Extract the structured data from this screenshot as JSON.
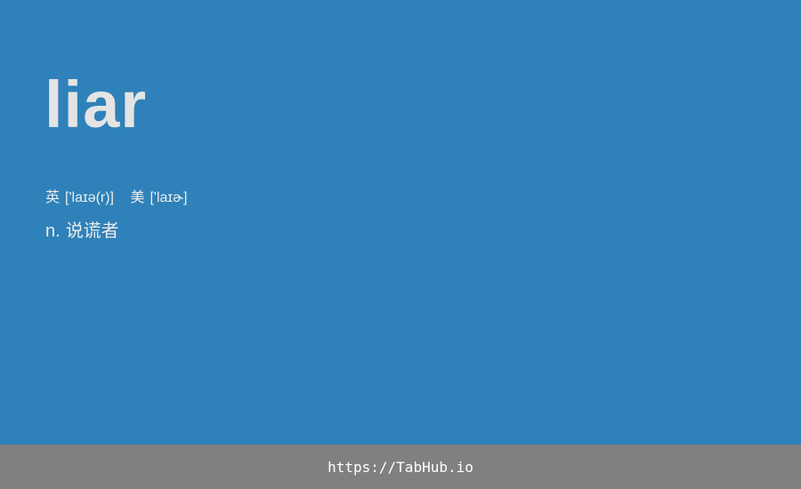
{
  "entry": {
    "word": "liar",
    "phonetics": [
      {
        "region": "英",
        "ipa": "['laɪə(r)]"
      },
      {
        "region": "美",
        "ipa": "['laɪɚ]"
      }
    ],
    "definition": {
      "pos": "n.",
      "meaning": "说谎者"
    }
  },
  "footer": {
    "link_text": "https://TabHub.io"
  },
  "colors": {
    "background": "#2f81b9",
    "footer_background": "#808080",
    "text": "#ececec"
  }
}
